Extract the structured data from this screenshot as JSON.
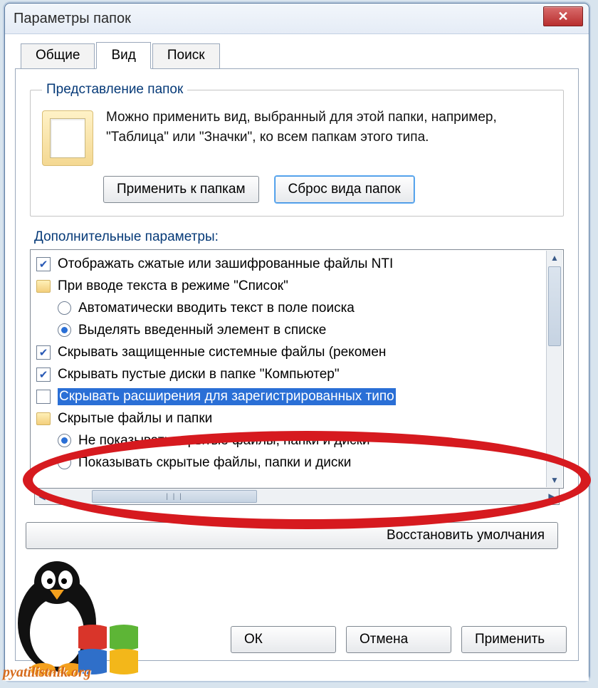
{
  "window": {
    "title": "Параметры папок"
  },
  "tabs": {
    "general": "Общие",
    "view": "Вид",
    "search": "Поиск"
  },
  "group": {
    "legend": "Представление папок",
    "text": "Можно применить вид, выбранный для этой папки, например, \"Таблица\" или \"Значки\", ко всем папкам этого типа.",
    "apply_btn": "Применить к папкам",
    "reset_btn": "Сброс вида папок"
  },
  "section_label": "Дополнительные параметры:",
  "items": [
    {
      "kind": "check",
      "checked": true,
      "text": "Отображать сжатые или зашифрованные файлы NTI"
    },
    {
      "kind": "folder",
      "text": "При вводе текста в режиме \"Список\""
    },
    {
      "kind": "radio",
      "checked": false,
      "indent": true,
      "text": "Автоматически вводить текст в поле поиска"
    },
    {
      "kind": "radio",
      "checked": true,
      "indent": true,
      "text": "Выделять введенный элемент в списке"
    },
    {
      "kind": "check",
      "checked": true,
      "text": "Скрывать защищенные системные файлы (рекомен"
    },
    {
      "kind": "check",
      "checked": true,
      "text": "Скрывать пустые диски в папке \"Компьютер\""
    },
    {
      "kind": "check",
      "checked": false,
      "selected": true,
      "text": "Скрывать расширения для зарегистрированных типо"
    },
    {
      "kind": "folder",
      "text": "Скрытые файлы и папки"
    },
    {
      "kind": "radio",
      "checked": true,
      "indent": true,
      "text": "Не показывать скрытые файлы, папки и диски"
    },
    {
      "kind": "radio",
      "checked": false,
      "indent": true,
      "text": "Показывать скрытые файлы, папки и диски"
    }
  ],
  "restore_btn": "Восстановить умолчания",
  "dialog": {
    "ok": "ОК",
    "cancel": "Отмена",
    "apply": "Применить"
  },
  "watermark_url": "pyatilistnik.org"
}
